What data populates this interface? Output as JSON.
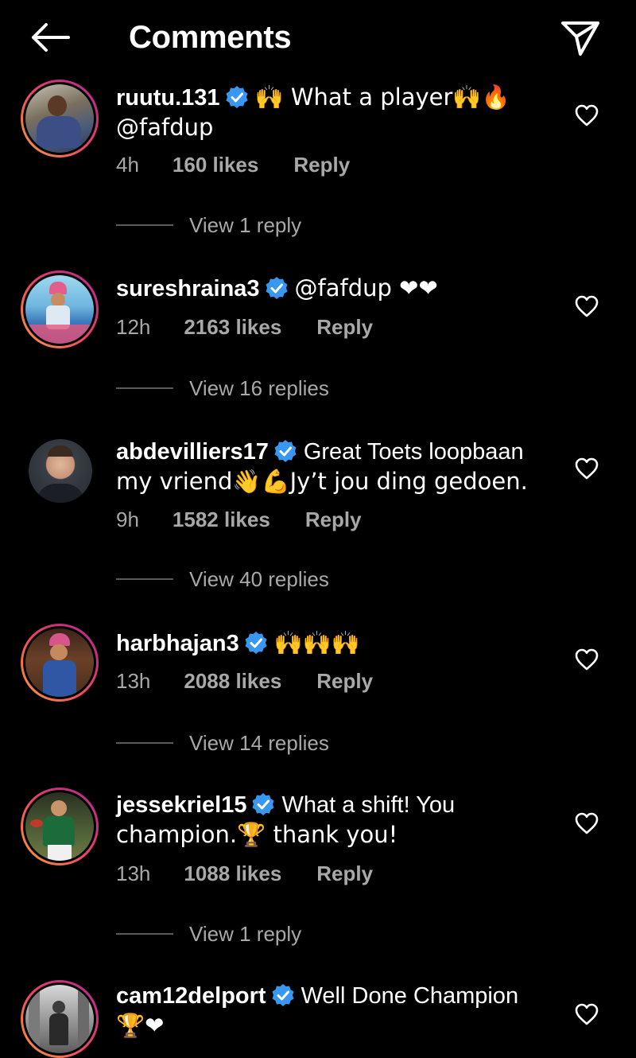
{
  "header": {
    "title": "Comments"
  },
  "comments": [
    {
      "username": "ruutu.131",
      "text_before": "🙌 What a player🙌🔥",
      "text_after": "@fafdup",
      "time": "4h",
      "likes": "160 likes",
      "reply": "Reply",
      "view_replies": "View 1 reply"
    },
    {
      "username": "sureshraina3",
      "text_before": "@fafdup ❤❤",
      "text_after": "",
      "time": "12h",
      "likes": "2163 likes",
      "reply": "Reply",
      "view_replies": "View 16 replies"
    },
    {
      "username": "abdevilliers17",
      "text_before": "Great Toets loopbaan",
      "text_after": "my vriend👋💪Jy’t jou ding gedoen.",
      "time": "9h",
      "likes": "1582 likes",
      "reply": "Reply",
      "view_replies": "View 40 replies"
    },
    {
      "username": "harbhajan3",
      "text_before": "🙌🙌🙌",
      "text_after": "",
      "time": "13h",
      "likes": "2088 likes",
      "reply": "Reply",
      "view_replies": "View 14 replies"
    },
    {
      "username": "jessekriel15",
      "text_before": "What a shift! You",
      "text_after": "champion.🏆 thank you!",
      "time": "13h",
      "likes": "1088 likes",
      "reply": "Reply",
      "view_replies": "View 1 reply"
    },
    {
      "username": "cam12delport",
      "text_before": "Well Done Champion",
      "text_after": "🏆❤",
      "time": "",
      "likes": "",
      "reply": "",
      "view_replies": ""
    }
  ],
  "colors": {
    "background": "#000000",
    "text": "#ffffff",
    "muted": "#a8a8a8",
    "verified": "#3897f0",
    "heart_emoji": "#e0102e"
  }
}
